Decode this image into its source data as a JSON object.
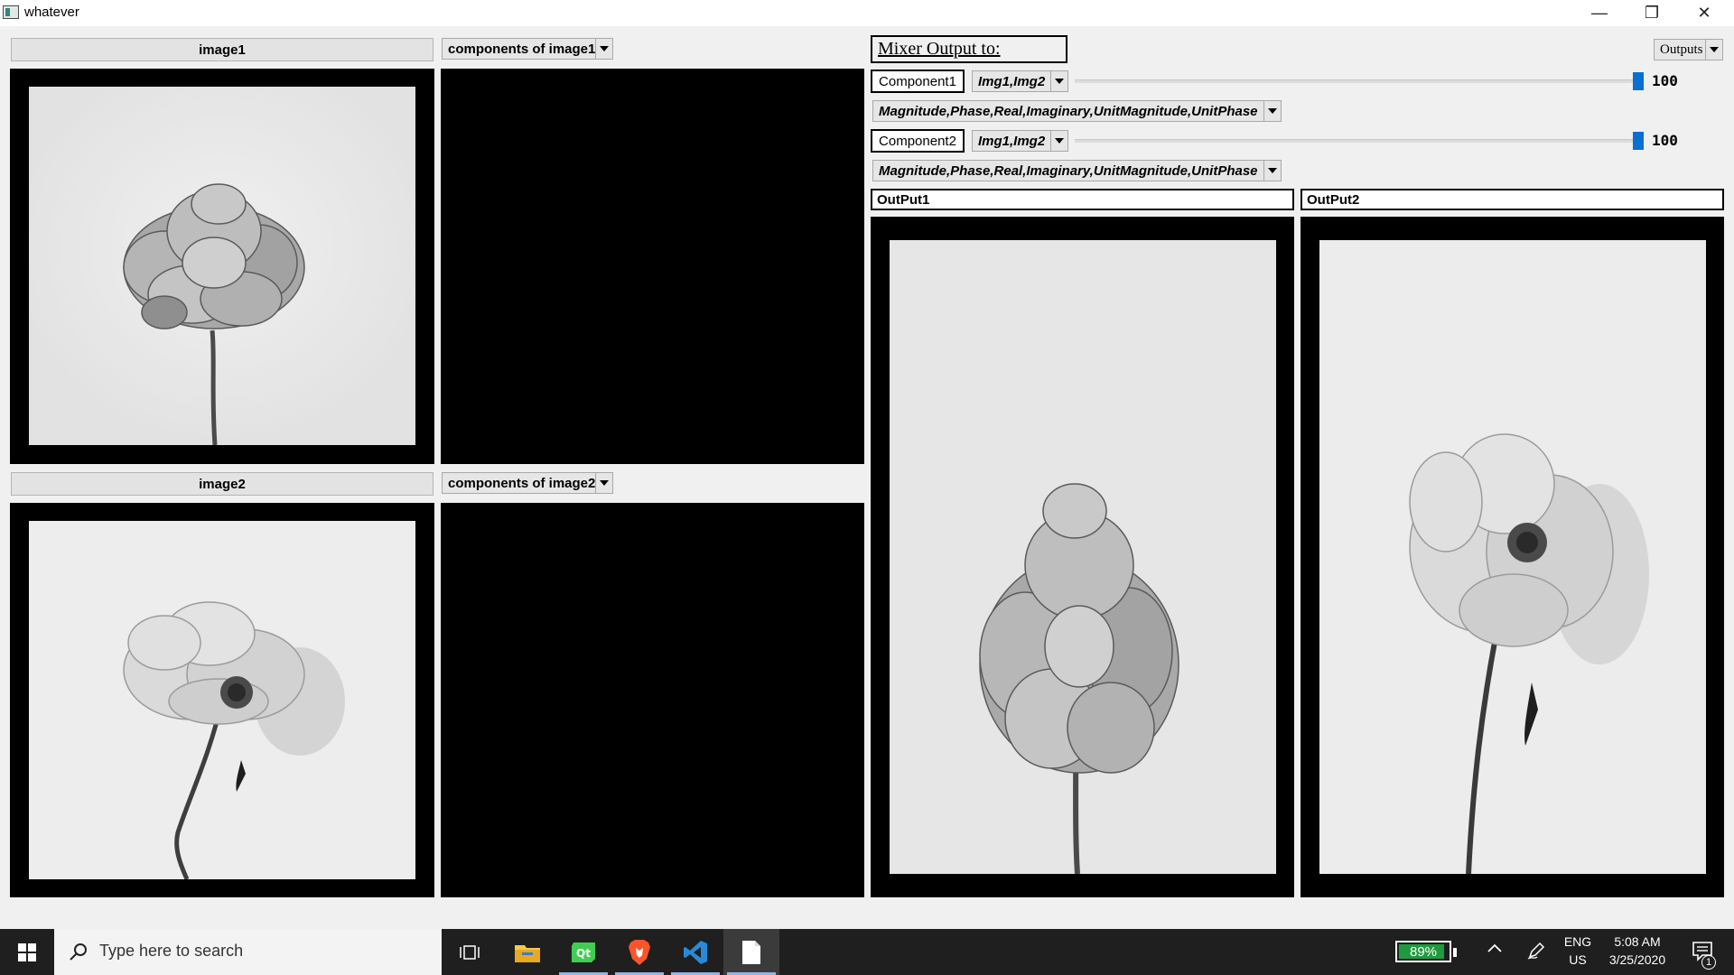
{
  "window": {
    "title": "whatever",
    "minimize_glyph": "—",
    "restore_glyph": "❐",
    "close_glyph": "✕"
  },
  "left_panels": {
    "image1": {
      "label": "image1",
      "components_label": "components of image1"
    },
    "image2": {
      "label": "image2",
      "components_label": "components of image2"
    }
  },
  "mixer": {
    "title": "Mixer Output to:",
    "outputs_label": "Outputs",
    "component1": {
      "label": "Component1",
      "source": "Img1,Img2",
      "value": "100",
      "fraction": 1.0,
      "mode": "Magnitude,Phase,Real,Imaginary,UnitMagnitude,UnitPhase"
    },
    "component2": {
      "label": "Component2",
      "source": "Img1,Img2",
      "value": "100",
      "fraction": 1.0,
      "mode": "Magnitude,Phase,Real,Imaginary,UnitMagnitude,UnitPhase"
    },
    "output1_label": "OutPut1",
    "output2_label": "OutPut2"
  },
  "taskbar": {
    "search_placeholder": "Type here to search",
    "battery": "89%",
    "battery_fraction": 0.89,
    "language": "ENG",
    "region": "US",
    "time": "5:08 AM",
    "date": "3/25/2020",
    "notification_count": "1",
    "icons": [
      "windows-start-icon",
      "task-view-icon",
      "file-explorer-icon",
      "qt-creator-icon",
      "brave-browser-icon",
      "vscode-icon",
      "document-icon"
    ]
  }
}
